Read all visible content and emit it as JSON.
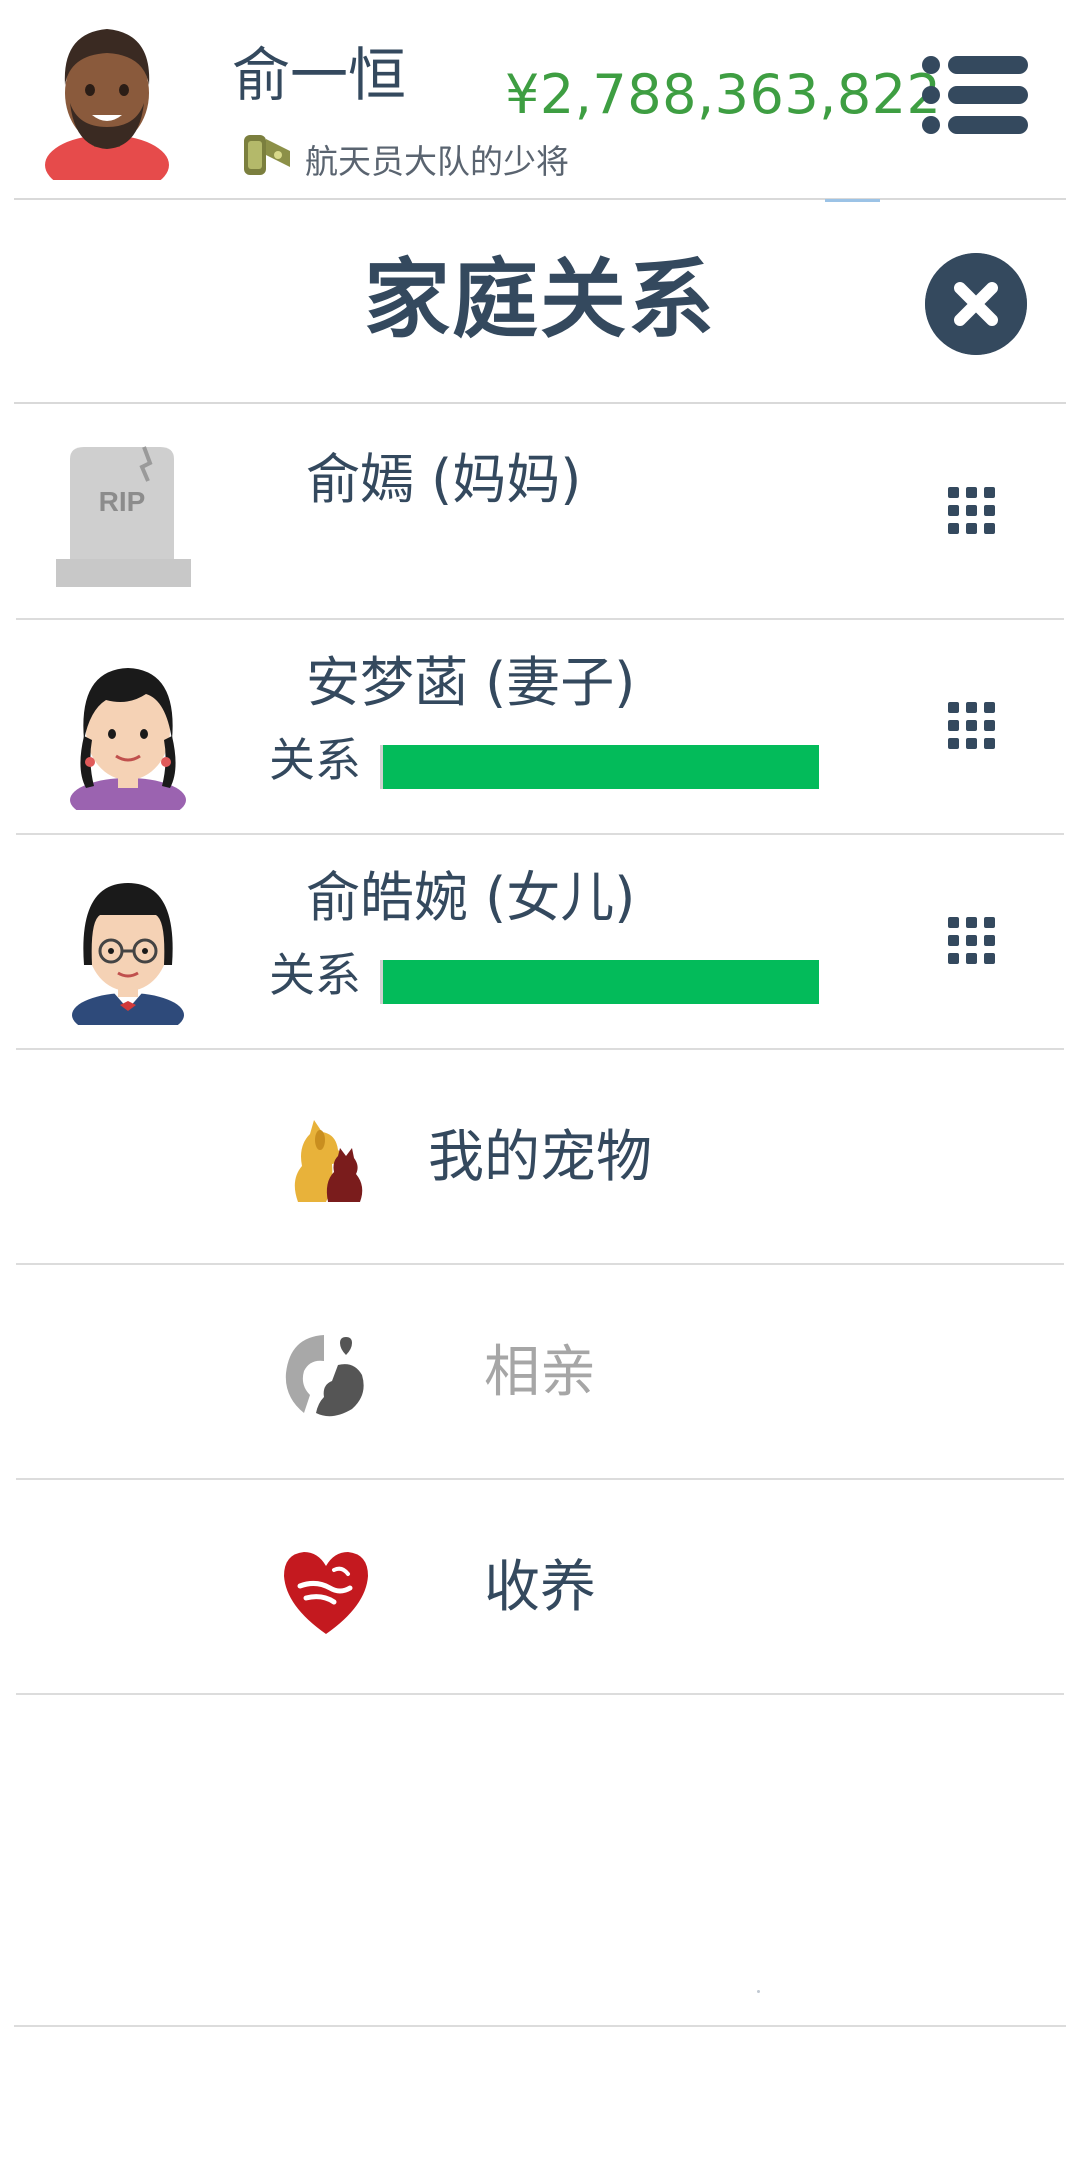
{
  "header": {
    "player_name": "俞一恒",
    "money": "¥2,788,363,822",
    "rank_title": "航天员大队的少将",
    "icons": {
      "avatar": "man-avatar",
      "rank": "military-rank-icon",
      "menu": "list-menu-icon"
    },
    "money_color": "#3e9e42"
  },
  "page": {
    "title": "家庭关系",
    "close_icon": "close-icon"
  },
  "family": [
    {
      "name": "俞嫣 (妈妈)",
      "portrait": "tombstone-rip",
      "tomb_text": "RIP",
      "deceased": true,
      "options_icon": "grid-dots-icon"
    },
    {
      "name": "安梦菡 (妻子)",
      "portrait": "girl-pigtails-avatar",
      "relationship_label": "关系",
      "relationship": 1.0,
      "options_icon": "grid-dots-icon"
    },
    {
      "name": "俞皓婉 (女儿)",
      "portrait": "girl-glasses-avatar",
      "relationship_label": "关系",
      "relationship": 1.0,
      "options_icon": "grid-dots-icon"
    }
  ],
  "actions": [
    {
      "label": "我的宠物",
      "icon": "pets-icon",
      "enabled": true,
      "color": "#34495e"
    },
    {
      "label": "相亲",
      "icon": "dating-couple-icon",
      "enabled": false,
      "color": "#a6a6a6"
    },
    {
      "label": "收养",
      "icon": "adoption-heart-icon",
      "enabled": true,
      "color": "#34495e"
    }
  ],
  "colors": {
    "primary": "#34495e",
    "relationship_bar": "#03bb5a",
    "divider": "#dcdcdc"
  }
}
